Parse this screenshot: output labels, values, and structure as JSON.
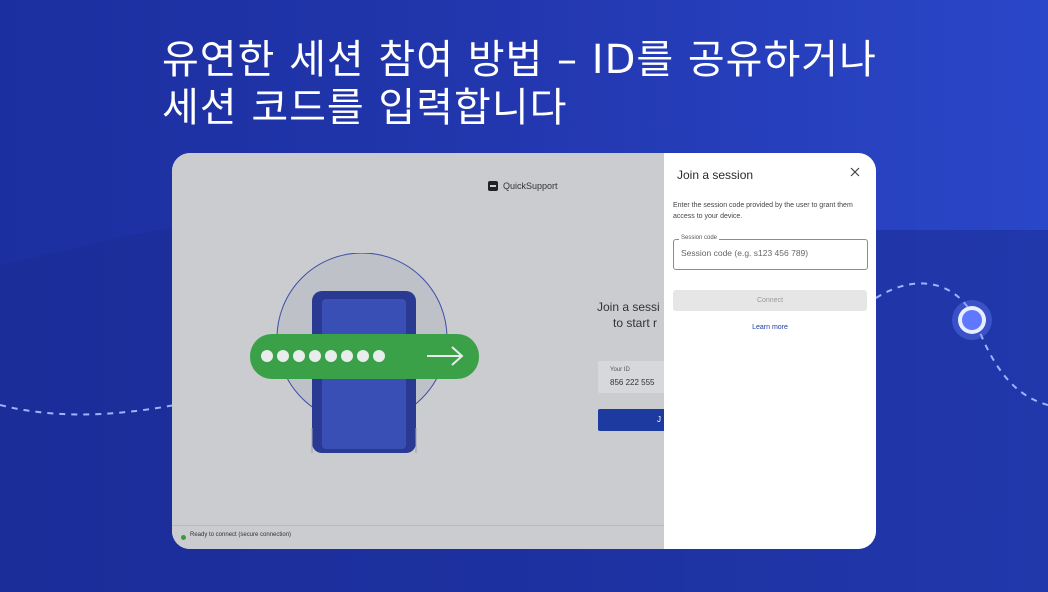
{
  "headline": {
    "line1": "유연한 세션 참여 방법 – ID를 공유하거나",
    "line2": "세션 코드를 입력합니다"
  },
  "app": {
    "brand": "QuickSupport",
    "join_text_line1": "Join a sessi",
    "join_text_line2": "to start r",
    "id_label": "Your ID",
    "id_value": "856 222 555",
    "join_button": "J",
    "status": "Ready to connect (secure connection)"
  },
  "panel": {
    "title": "Join a session",
    "description": "Enter the session code provided by the user to grant them access to your device.",
    "field_label": "Session code",
    "field_placeholder": "Session code (e.g. s123 456 789)",
    "field_value": "",
    "connect": "Connect",
    "learn_more": "Learn more"
  },
  "colors": {
    "background": "#2236ad",
    "accent": "#1d3aa0",
    "green": "#3aa148",
    "status_ok": "#3a9a3a"
  },
  "icons": [
    "quicksupport-logo-icon",
    "close-icon",
    "password-dots-icon",
    "arrow-right-icon",
    "location-pin-icon"
  ]
}
